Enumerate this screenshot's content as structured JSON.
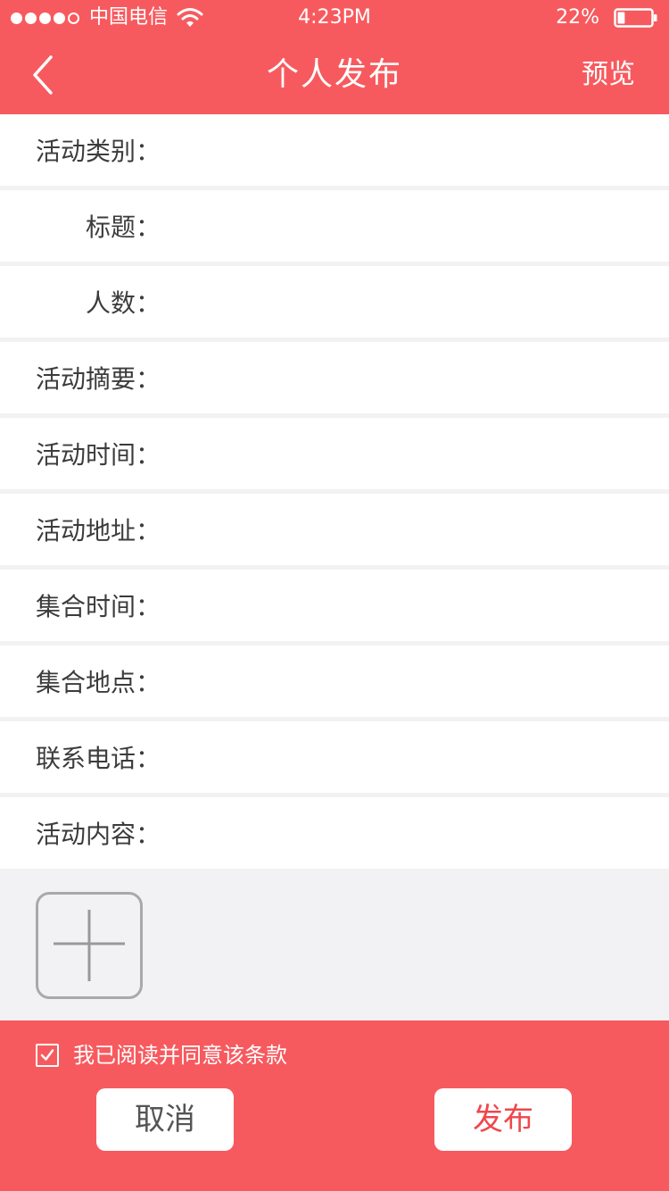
{
  "status_bar": {
    "carrier": "中国电信",
    "time": "4:23PM",
    "battery": "22%",
    "signal_filled": 4,
    "signal_total": 5,
    "battery_level": 0.22
  },
  "nav": {
    "title": "个人发布",
    "preview_label": "预览",
    "back_icon": "chevron-left-icon"
  },
  "form": {
    "fields": [
      {
        "label": "活动类别：",
        "value": ""
      },
      {
        "label": "标题：",
        "value": ""
      },
      {
        "label": "人数：",
        "value": ""
      },
      {
        "label": "活动摘要：",
        "value": ""
      },
      {
        "label": "活动时间：",
        "value": ""
      },
      {
        "label": "活动地址：",
        "value": ""
      },
      {
        "label": "集合时间：",
        "value": ""
      },
      {
        "label": "集合地点：",
        "value": ""
      },
      {
        "label": "联系电话：",
        "value": ""
      },
      {
        "label": "活动内容：",
        "value": ""
      }
    ]
  },
  "upload": {
    "icon": "plus-icon"
  },
  "footer": {
    "agree_text": "我已阅读并同意该条款",
    "agree_checked": true,
    "cancel_label": "取消",
    "publish_label": "发布"
  },
  "colors": {
    "accent": "#f75a5e",
    "publish_text": "#f0474c",
    "label_text": "#3c3c3c",
    "background": "#f2f2f4"
  }
}
